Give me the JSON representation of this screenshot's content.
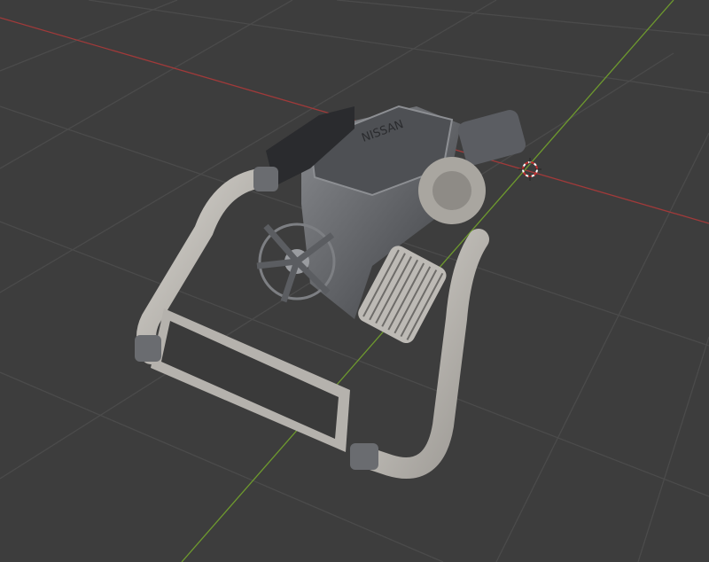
{
  "viewport": {
    "background_color": "#3d3d3d",
    "grid_color": "#4a4a4a",
    "x_axis_color": "#a03a3a",
    "y_axis_color": "#6e9a2e",
    "cursor_icon": "3d-cursor-icon"
  },
  "model": {
    "logo_text": "NISSAN",
    "pipe_color": "#b9b6b0",
    "engine_color": "#5a5c60"
  }
}
